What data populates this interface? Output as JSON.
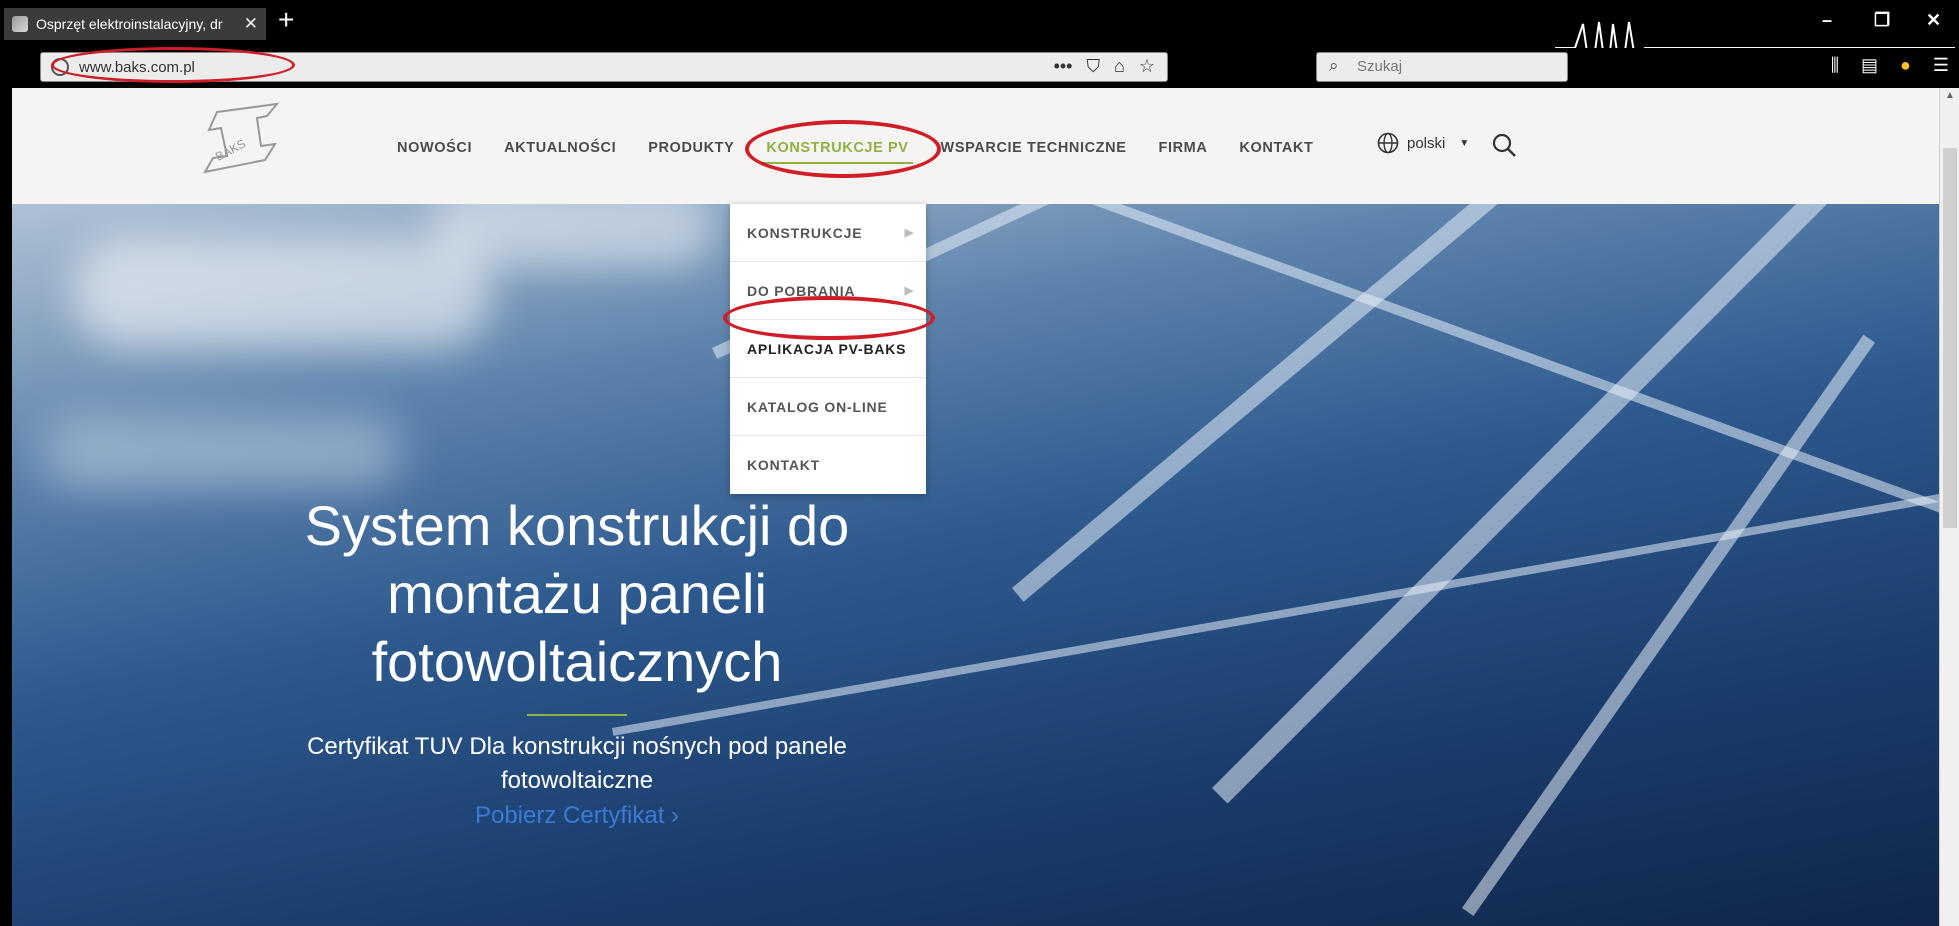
{
  "browser": {
    "tab_title": "Osprzęt elektroinstalacyjny, dr",
    "url": "www.baks.com.pl",
    "search_placeholder": "Szukaj"
  },
  "site": {
    "logo_text": "BAKS",
    "nav": [
      "NOWOŚCI",
      "AKTUALNOŚCI",
      "PRODUKTY",
      "KONSTRUKCJE PV",
      "WSPARCIE TECHNICZNE",
      "FIRMA",
      "KONTAKT"
    ],
    "active_nav": "KONSTRUKCJE PV",
    "language": "polski",
    "dropdown": [
      "KONSTRUKCJE",
      "DO POBRANIA",
      "APLIKACJA PV-BAKS",
      "KATALOG ON-LINE",
      "KONTAKT"
    ],
    "accent_color": "#8fb143",
    "annotation_color": "#d01e28"
  },
  "hero": {
    "heading_line1": "System konstrukcji do",
    "heading_line2": "montażu paneli",
    "heading_line3": "fotowoltaicznych",
    "subtext": "Certyfikat TUV Dla konstrukcji nośnych pod panele fotowoltaiczne",
    "link": "Pobierz Certyfikat ›"
  }
}
